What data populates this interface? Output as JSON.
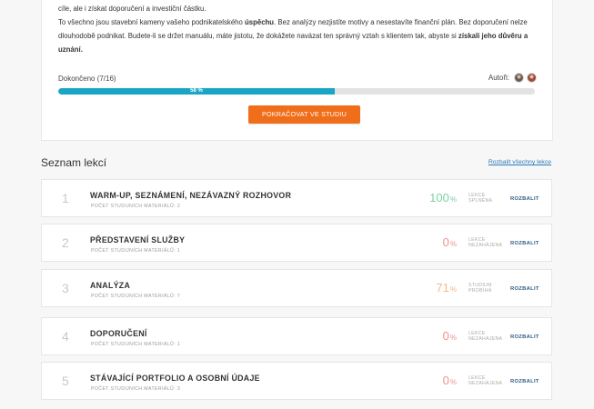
{
  "intro": {
    "line1": "cíle, ale i získat doporučení a investiční částku.",
    "p2_a": "To všechno jsou stavební kameny vašeho podnikatelského ",
    "p2_b": "úspěchu",
    "p2_c": ". Bez analýzy nezjistíte motivy a nesestavíte finanční plán. Bez doporučení nelze dlouhodobě podnikat. Budete-li se držet manuálu, máte jistotu, že dokážete navázat ten správný vztah s klientem tak, abyste si ",
    "p2_d": "získali jeho důvěru a uznání."
  },
  "progress": {
    "label": "Dokončeno (7/16)",
    "percent_text": "58 %",
    "percent": 58,
    "authors_label": "Autoři:"
  },
  "continue_button": "POKRAČOVAT VE STUDIU",
  "lessons_title": "Seznam lekcí",
  "expand_all": "Rozbalit všechny lekce",
  "lessons": [
    {
      "num": "1",
      "title": "WARM-UP, SEZNÁMENÍ, NEZÁVAZNÝ ROZHOVOR",
      "sub": "POČET STUDIJNÍCH MATERIÁLŮ: 2",
      "pct": "100",
      "pct_sign": "%",
      "status1": "LEKCE",
      "status2": "SPLNĚNA",
      "color": "#7ed0a6",
      "expand": "ROZBALIT"
    },
    {
      "num": "2",
      "title": "PŘEDSTAVENÍ SLUŽBY",
      "sub": "POČET STUDIJNÍCH MATERIÁLŮ: 1",
      "pct": "0",
      "pct_sign": "%",
      "status1": "LEKCE",
      "status2": "NEZAHÁJENA",
      "color": "#f29191",
      "expand": "ROZBALIT"
    },
    {
      "num": "3",
      "title": "ANALÝZA",
      "sub": "POČET STUDIJNÍCH MATERIÁLŮ: 7",
      "pct": "71",
      "pct_sign": "%",
      "status1": "STUDIUM",
      "status2": "PROBÍHÁ",
      "color": "#f5b78a",
      "expand": "ROZBALIT"
    },
    {
      "num": "4",
      "title": "DOPORUČENÍ",
      "sub": "POČET STUDIJNÍCH MATERIÁLŮ: 1",
      "pct": "0",
      "pct_sign": "%",
      "status1": "LEKCE",
      "status2": "NEZAHÁJENA",
      "color": "#f29191",
      "expand": "ROZBALIT"
    },
    {
      "num": "5",
      "title": "STÁVAJÍCÍ PORTFOLIO A OSOBNÍ ÚDAJE",
      "sub": "POČET STUDIJNÍCH MATERIÁLŮ: 3",
      "pct": "0",
      "pct_sign": "%",
      "status1": "LEKCE",
      "status2": "NEZAHÁJENA",
      "color": "#f29191",
      "expand": "ROZBALIT"
    }
  ]
}
